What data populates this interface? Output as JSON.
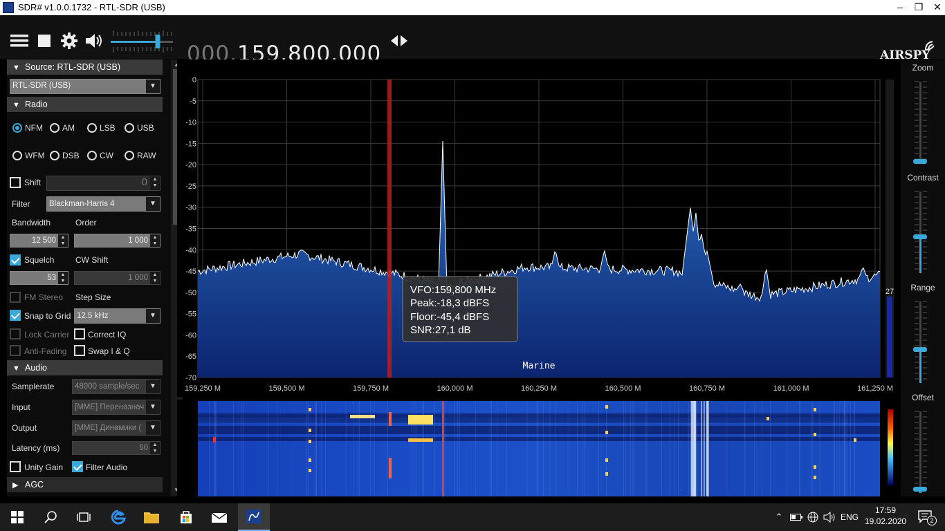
{
  "window": {
    "title": "SDR# v1.0.0.1732 - RTL-SDR (USB)",
    "minimize": "–",
    "restore": "❐",
    "close": "✕"
  },
  "toolbar": {
    "freq_prefix": "000.",
    "freq_main": "159.800.000",
    "brand": "AIRSPY",
    "volume_level": 0.75
  },
  "source": {
    "header": "Source: RTL-SDR (USB)",
    "device": "RTL-SDR (USB)"
  },
  "radio": {
    "header": "Radio",
    "modes": [
      "NFM",
      "AM",
      "LSB",
      "USB",
      "WFM",
      "DSB",
      "CW",
      "RAW"
    ],
    "selected_mode": "NFM",
    "shift_label": "Shift",
    "shift_value": "0",
    "filter_label": "Filter",
    "filter_value": "Blackman-Harris 4",
    "bandwidth_label": "Bandwidth",
    "bandwidth_value": "12 500",
    "order_label": "Order",
    "order_value": "1 000",
    "squelch_label": "Squelch",
    "squelch_value": "53",
    "cw_shift_label": "CW Shift",
    "cw_shift_value": "1 000",
    "fm_stereo_label": "FM Stereo",
    "step_size_label": "Step Size",
    "snap_label": "Snap to Grid",
    "step_value": "12.5 kHz",
    "lock_carrier_label": "Lock Carrier",
    "correct_iq_label": "Correct IQ",
    "anti_fading_label": "Anti-Fading",
    "swap_iq_label": "Swap I & Q"
  },
  "audio": {
    "header": "Audio",
    "samplerate_label": "Samplerate",
    "samplerate_value": "48000 sample/sec",
    "input_label": "Input",
    "input_value": "[MME] Переназнач",
    "output_label": "Output",
    "output_value": "[MME] Динамики (",
    "latency_label": "Latency (ms)",
    "latency_value": "50",
    "unity_gain_label": "Unity Gain",
    "filter_audio_label": "Filter Audio"
  },
  "agc": {
    "header": "AGC"
  },
  "spectrum": {
    "y_ticks": [
      "0",
      "-5",
      "-10",
      "-15",
      "-20",
      "-25",
      "-30",
      "-35",
      "-40",
      "-45",
      "-50",
      "-55",
      "-60",
      "-65",
      "-70"
    ],
    "x_ticks": [
      "159,250 M",
      "159,500 M",
      "159,750 M",
      "160,000 M",
      "160,250 M",
      "160,500 M",
      "160,750 M",
      "161,000 M",
      "161,250 M"
    ],
    "band_label": "Marine",
    "snr_marker": "27",
    "tooltip": {
      "vfo": "VFO:159,800 MHz",
      "peak": "Peak:-18,3 dBFS",
      "floor": "Floor:-45,4 dBFS",
      "snr": "SNR:27,1 dB"
    }
  },
  "right_panel": {
    "zoom_label": "Zoom",
    "contrast_label": "Contrast",
    "range_label": "Range",
    "offset_label": "Offset"
  },
  "taskbar": {
    "lang": "ENG",
    "time": "17:59",
    "date": "19.02.2020",
    "notifications": "2"
  },
  "colors": {
    "accent": "#3aa8d8",
    "spectrum_fill": "#1e4f9a",
    "trace": "#ffffff",
    "vfo_marker": "#b52020"
  }
}
